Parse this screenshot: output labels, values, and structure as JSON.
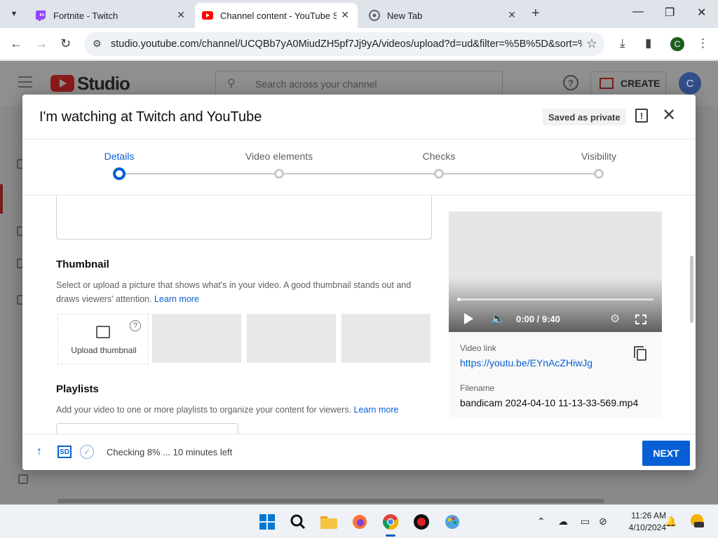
{
  "browser": {
    "tabs": [
      {
        "label": "Fortnite - Twitch",
        "favicon": "twitch-icon"
      },
      {
        "label": "Channel content - YouTube Studio",
        "favicon": "youtube-icon"
      },
      {
        "label": "New Tab",
        "favicon": "chrome-icon"
      }
    ],
    "url": "studio.youtube.com/channel/UCQBb7yA0MiudZH5pf7Jj9yA/videos/upload?d=ud&filter=%5B%5D&sort=%...",
    "profile_initial": "C"
  },
  "studio": {
    "logo_text": "Studio",
    "search_placeholder": "Search across your channel",
    "help_glyph": "?",
    "create_label": "CREATE",
    "avatar_initial": "C"
  },
  "modal": {
    "title": "I'm watching at Twitch and YouTube",
    "saved_badge": "Saved as private",
    "report_glyph": "!",
    "close_glyph": "✕",
    "steps": [
      {
        "label": "Details",
        "active": true
      },
      {
        "label": "Video elements",
        "active": false
      },
      {
        "label": "Checks",
        "active": false
      },
      {
        "label": "Visibility",
        "active": false
      }
    ],
    "thumbnail": {
      "title": "Thumbnail",
      "description": "Select or upload a picture that shows what's in your video. A good thumbnail stands out and draws viewers' attention.",
      "learn_more": "Learn more",
      "upload_label": "Upload thumbnail",
      "help_glyph": "?"
    },
    "playlists": {
      "title": "Playlists",
      "description": "Add your video to one or more playlists to organize your content for viewers.",
      "learn_more": "Learn more"
    },
    "video": {
      "time": "0:00 / 9:40",
      "link_label": "Video link",
      "link": "https://youtu.be/EYnAcZHiwJg",
      "filename_label": "Filename",
      "filename": "bandicam 2024-04-10 11-13-33-569.mp4"
    },
    "footer": {
      "sd_label": "SD",
      "status": "Checking 8% ... 10 minutes left",
      "next_label": "NEXT"
    }
  },
  "taskbar": {
    "time": "11:26 AM",
    "date": "4/10/2024"
  },
  "colors": {
    "accent": "#065fd4",
    "youtube_red": "#ff0000",
    "twitch_purple": "#9146ff"
  }
}
